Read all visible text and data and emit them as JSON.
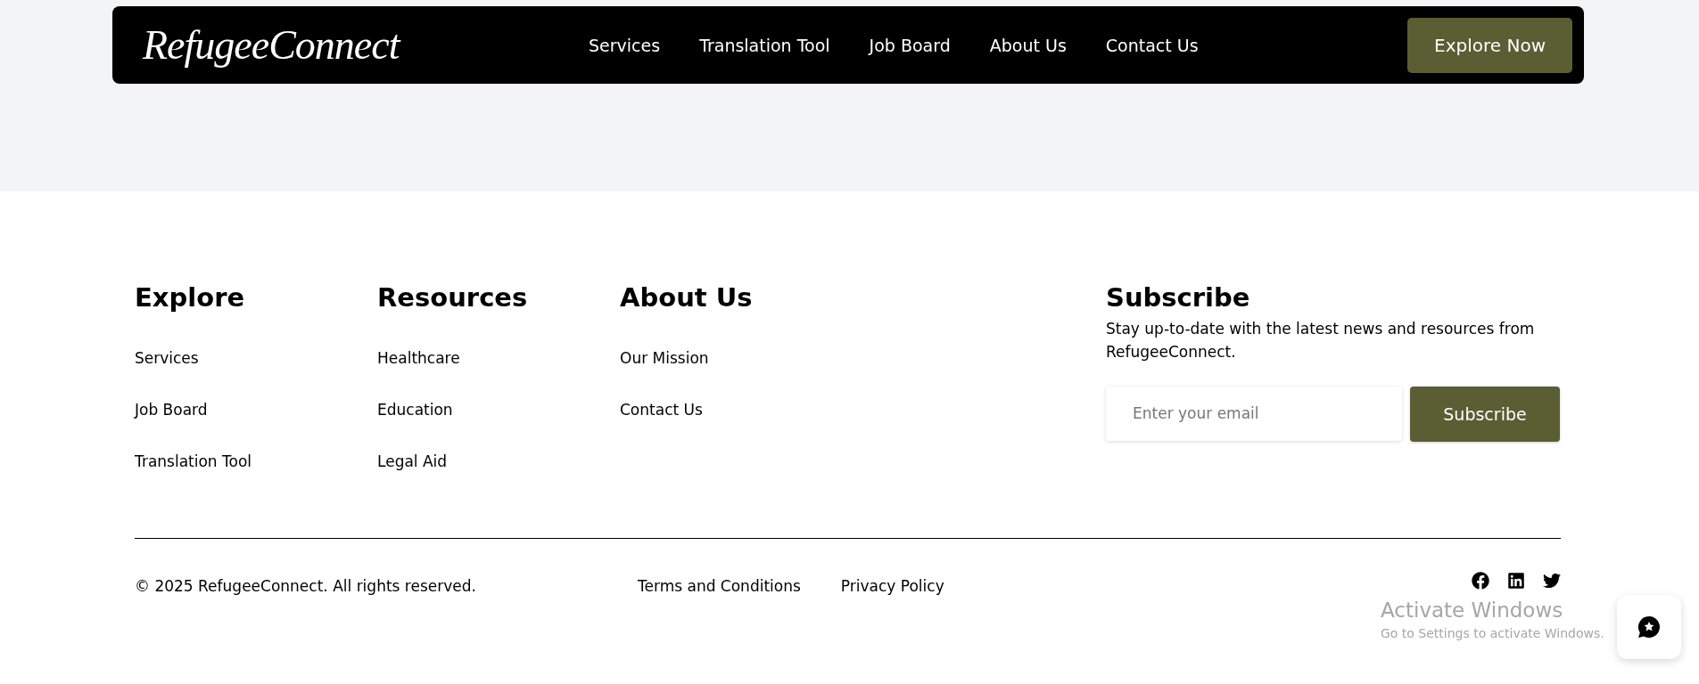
{
  "navbar": {
    "logo": "RefugeeConnect",
    "links": [
      "Services",
      "Translation Tool",
      "Job Board",
      "About Us",
      "Contact Us"
    ],
    "cta": "Explore Now"
  },
  "footer": {
    "columns": [
      {
        "heading": "Explore",
        "links": [
          "Services",
          "Job Board",
          "Translation Tool"
        ]
      },
      {
        "heading": "Resources",
        "links": [
          "Healthcare",
          "Education",
          "Legal Aid"
        ]
      },
      {
        "heading": "About Us",
        "links": [
          "Our Mission",
          "Contact Us"
        ]
      }
    ],
    "subscribe": {
      "heading": "Subscribe",
      "text": "Stay up-to-date with the latest news and resources from RefugeeConnect.",
      "placeholder": "Enter your email",
      "button": "Subscribe"
    },
    "copyright": "© 2025 RefugeeConnect. All rights reserved.",
    "legal_links": [
      "Terms and Conditions",
      "Privacy Policy"
    ]
  },
  "system_overlay": {
    "title": "Activate Windows",
    "subtitle": "Go to Settings to activate Windows."
  }
}
